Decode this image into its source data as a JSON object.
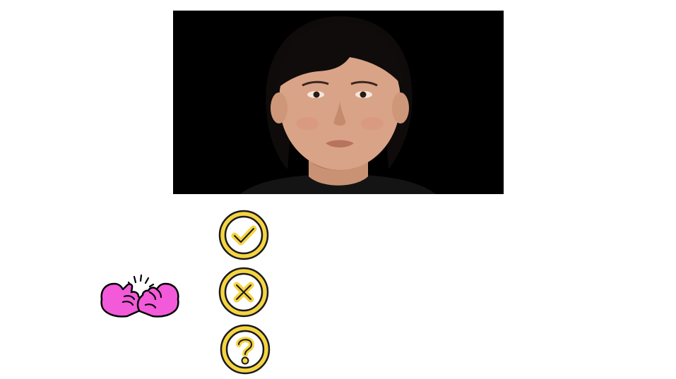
{
  "photo": {
    "subject": "portrait photo",
    "background_color": "#000000"
  },
  "pinky_promise": {
    "icon": "pinky-promise-icon",
    "color": "#f25ad9",
    "outline_color": "#000000"
  },
  "answers": {
    "accent_color": "#f5d442",
    "outline_color": "#1a1a1a",
    "options": [
      {
        "icon": "check-icon"
      },
      {
        "icon": "cross-icon"
      },
      {
        "icon": "question-icon"
      }
    ]
  }
}
